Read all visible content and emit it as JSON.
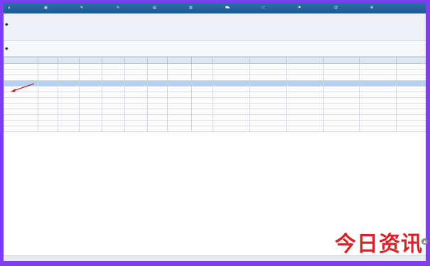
{
  "nav": {
    "items": [
      {
        "icon": "home-icon",
        "glyph": "⌂",
        "label": ""
      },
      {
        "icon": "grid-icon",
        "glyph": "▦",
        "label": ""
      },
      {
        "icon": "edit-icon",
        "glyph": "✎",
        "label": ""
      },
      {
        "icon": "edit-icon",
        "glyph": "✎",
        "label": ""
      },
      {
        "icon": "document-icon",
        "glyph": "▤",
        "label": ""
      },
      {
        "icon": "chart-icon",
        "glyph": "▥",
        "label": ""
      },
      {
        "icon": "truck-icon",
        "glyph": "⛟",
        "label": ""
      },
      {
        "icon": "folder-icon",
        "glyph": "▭",
        "label": ""
      },
      {
        "icon": "tag-icon",
        "glyph": "⚑",
        "label": ""
      },
      {
        "icon": "user-icon",
        "glyph": "☺",
        "label": ""
      },
      {
        "icon": "settings-icon",
        "glyph": "⚙",
        "label": ""
      }
    ]
  },
  "grid": {
    "headers": [
      "",
      "",
      "",
      "",
      "",
      "",
      "",
      "",
      "",
      "",
      "",
      "",
      "",
      "",
      ""
    ],
    "rows": [
      {
        "cells": [
          "",
          "",
          "",
          "",
          "",
          "",
          "",
          "",
          "",
          "",
          "",
          "",
          "",
          "",
          ""
        ]
      },
      {
        "cells": [
          "",
          "",
          "",
          "",
          "",
          "",
          "",
          "",
          "",
          "",
          "",
          "",
          "",
          "",
          ""
        ]
      },
      {
        "cells": [
          "",
          "",
          "",
          "",
          "",
          "",
          "",
          "",
          "",
          "",
          "",
          "",
          "",
          "",
          ""
        ]
      },
      {
        "cells": [
          "",
          "",
          "",
          "",
          "",
          "",
          "",
          "",
          "",
          "",
          "",
          "",
          "",
          "",
          ""
        ],
        "selected": true
      },
      {
        "cells": [
          "",
          "",
          "",
          "",
          "",
          "",
          "",
          "",
          "",
          "",
          "",
          "",
          "",
          "",
          ""
        ]
      },
      {
        "cells": [
          "",
          "",
          "",
          "",
          "",
          "",
          "",
          "",
          "",
          "",
          "",
          "",
          "",
          "",
          ""
        ]
      },
      {
        "cells": [
          "",
          "",
          "",
          "",
          "",
          "",
          "",
          "",
          "",
          "",
          "",
          "",
          "",
          "",
          ""
        ]
      },
      {
        "cells": [
          "",
          "",
          "",
          "",
          "",
          "",
          "",
          "",
          "",
          "",
          "",
          "",
          "",
          "",
          ""
        ]
      },
      {
        "cells": [
          "",
          "",
          "",
          "",
          "",
          "",
          "",
          "",
          "",
          "",
          "",
          "",
          "",
          "",
          ""
        ]
      },
      {
        "cells": [
          "",
          "",
          "",
          "",
          "",
          "",
          "",
          "",
          "",
          "",
          "",
          "",
          "",
          "",
          ""
        ]
      },
      {
        "cells": [
          "",
          "",
          "",
          "",
          "",
          "",
          "",
          "",
          "",
          "",
          "",
          "",
          "",
          "",
          ""
        ]
      },
      {
        "cells": [
          "",
          "",
          "",
          "",
          "",
          "",
          "",
          "",
          "",
          "",
          "",
          "",
          "",
          "",
          ""
        ]
      }
    ]
  },
  "toolbar": {
    "mark_top": "◆",
    "mark_bottom": "◆"
  },
  "watermark": {
    "text": "今日资讯"
  },
  "colors": {
    "nav": "#1c5a92",
    "selected_row": "#b7d1f2",
    "frame": "#7d3df0",
    "watermark": "#d9232a"
  }
}
